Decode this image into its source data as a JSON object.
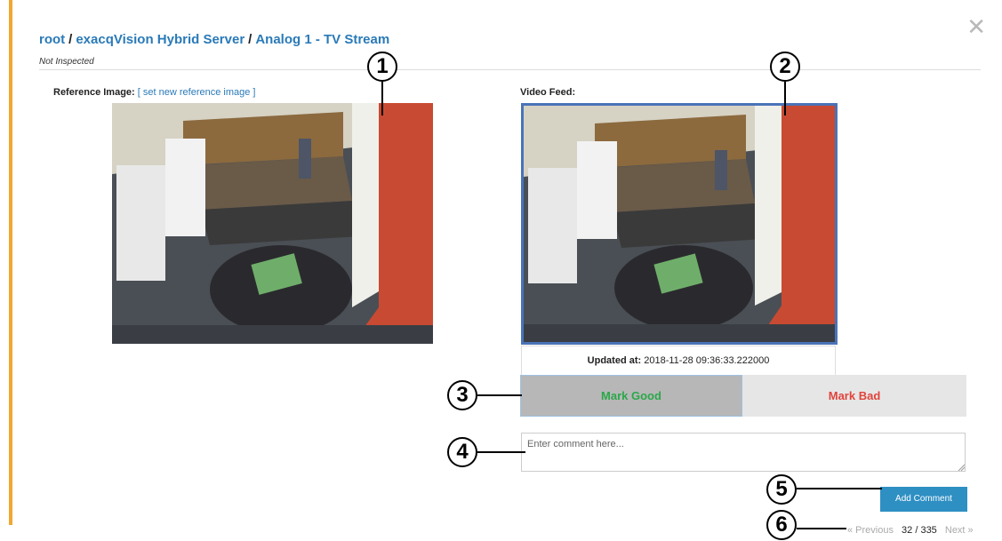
{
  "header": {
    "crumb_root": "root",
    "crumb_server": "exacqVision Hybrid Server",
    "crumb_camera": "Analog 1 - TV Stream",
    "separator": "/",
    "status": "Not Inspected",
    "close_glyph": "✕"
  },
  "reference": {
    "label": "Reference Image:",
    "link": "[ set new reference image ]"
  },
  "feed": {
    "label": "Video Feed:",
    "updated_label": "Updated at:",
    "updated_value": "2018-11-28 09:36:33.222000"
  },
  "actions": {
    "mark_good": "Mark Good",
    "mark_bad": "Mark Bad",
    "comment_placeholder": "Enter comment here...",
    "add_comment": "Add Comment"
  },
  "pager": {
    "previous": "« Previous",
    "count": "32 / 335",
    "next": "Next »"
  },
  "callouts": [
    "1",
    "2",
    "3",
    "4",
    "5",
    "6"
  ],
  "colors": {
    "accent_bar": "#f0a830",
    "link": "#2a7ab8",
    "good": "#2aa84a",
    "bad": "#e0443c",
    "button": "#2e8fc3",
    "feed_border": "#4a73b8"
  }
}
